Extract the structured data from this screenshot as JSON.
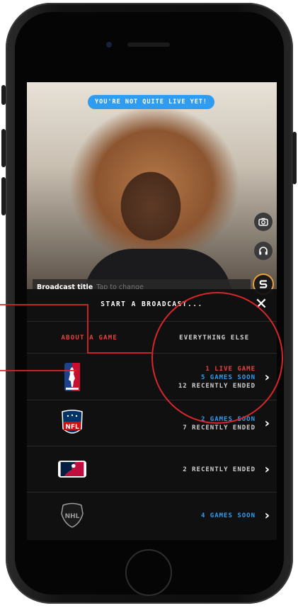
{
  "video": {
    "banner": "YOU'RE NOT QUITE LIVE YET!",
    "title_label": "Broadcast title",
    "title_placeholder": "Tap to change",
    "controls": [
      "camera-flip-icon",
      "headphones-icon",
      "app-logo-icon"
    ]
  },
  "panel": {
    "title": "START A BROADCAST...",
    "close_icon": "close-icon",
    "tabs": [
      {
        "label": "ABOUT A GAME",
        "active": true
      },
      {
        "label": "EVERYTHING ELSE",
        "active": false
      }
    ],
    "leagues": [
      {
        "league": "NBA",
        "icon": "nba-logo-icon",
        "live": "1 LIVE GAME",
        "soon": "5 GAMES SOON",
        "ended": "12 RECENTLY ENDED"
      },
      {
        "league": "NFL",
        "icon": "nfl-logo-icon",
        "live": "",
        "soon": "2 GAMES SOON",
        "ended": "7 RECENTLY ENDED"
      },
      {
        "league": "MLB",
        "icon": "mlb-logo-icon",
        "live": "",
        "soon": "",
        "ended": "2 RECENTLY ENDED"
      },
      {
        "league": "NHL",
        "icon": "nhl-logo-icon",
        "live": "",
        "soon": "4 GAMES SOON",
        "ended": ""
      }
    ]
  },
  "colors": {
    "accent_blue": "#2f9cf0",
    "accent_red": "#e8423f",
    "annotation_red": "#d9262b"
  }
}
